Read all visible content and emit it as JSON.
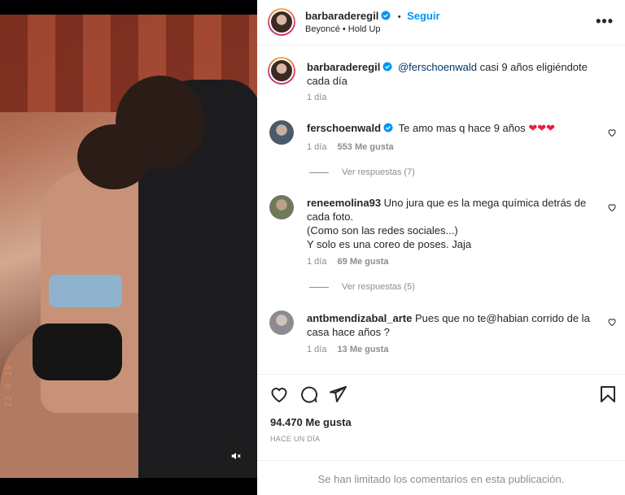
{
  "post": {
    "author": "barbaraderegil",
    "follow_label": "Seguir",
    "separator": "•",
    "audio": "Beyoncé • Hold Up",
    "more_label": "•••",
    "photo_date_stamp": "22 4 29"
  },
  "caption": {
    "author": "barbaraderegil",
    "mention": "@ferschoenwald",
    "text_line1": "casi 9 años eligiéndote",
    "text_line2": "cada día",
    "time": "1 día"
  },
  "comments": [
    {
      "user": "ferschoenwald",
      "text": "Te amo mas q hace 9 años",
      "emoji": "❤❤❤",
      "time": "1 día",
      "likes": "553 Me gusta",
      "replies": "Ver respuestas (7)"
    },
    {
      "user": "reneemolina93",
      "text_line1": "Uno jura que es la mega química detrás de",
      "text_line2": "cada foto.",
      "text_line3": "(Como son las redes sociales...)",
      "text_line4": "Y solo es una coreo de poses. Jaja",
      "time": "1 día",
      "likes": "69 Me gusta",
      "replies": "Ver respuestas (5)"
    },
    {
      "user": "antbmendizabal_arte",
      "text_line1": "Pues que no te@habian corrido de la",
      "text_line2": "casa hace años ?",
      "time": "1 día",
      "likes": "13 Me gusta"
    }
  ],
  "stats": {
    "likes": "94.470 Me gusta",
    "ago": "HACE UN DÍA"
  },
  "footer": {
    "limited_text": "Se han limitado los comentarios en esta publicación."
  },
  "colors": {
    "accent": "#0095f6",
    "heart": "#ed1c40",
    "muted": "#8e8e8e"
  }
}
